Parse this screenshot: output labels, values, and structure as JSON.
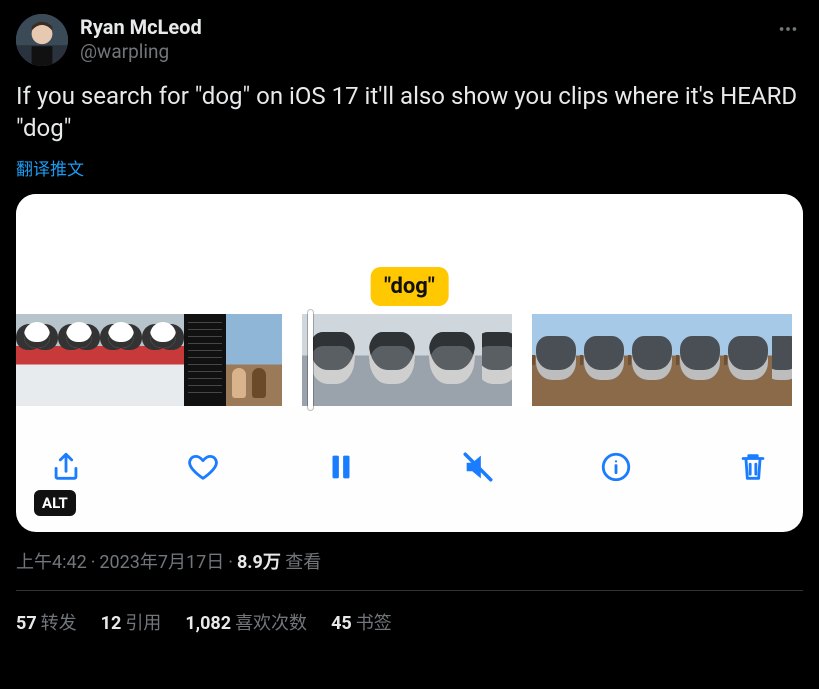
{
  "author": {
    "display_name": "Ryan McLeod",
    "handle": "@warpling"
  },
  "tweet_text": "If you search for \"dog\" on iOS 17 it'll also show you clips where it's HEARD \"dog\"",
  "translate_label": "翻译推文",
  "media": {
    "bubble_text": "\"dog\"",
    "alt_badge": "ALT"
  },
  "meta": {
    "time": "上午4:42",
    "date": "2023年7月17日",
    "views_number": "8.9万",
    "views_label": "查看"
  },
  "stats": {
    "retweets_count": "57",
    "retweets_label": "转发",
    "quotes_count": "12",
    "quotes_label": "引用",
    "likes_count": "1,082",
    "likes_label": "喜欢次数",
    "bookmarks_count": "45",
    "bookmarks_label": "书签"
  }
}
